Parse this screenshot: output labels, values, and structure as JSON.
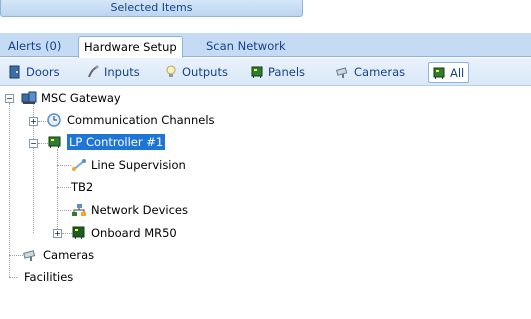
{
  "top": {
    "selected_items_label": "Selected Items"
  },
  "tabs": [
    {
      "label": "Alerts (0)",
      "active": false
    },
    {
      "label": "Hardware Setup",
      "active": true
    },
    {
      "label": "Scan Network",
      "active": false
    }
  ],
  "filters": [
    {
      "label": "Doors",
      "icon": "door-icon"
    },
    {
      "label": "Inputs",
      "icon": "input-icon"
    },
    {
      "label": "Outputs",
      "icon": "lightbulb-icon"
    },
    {
      "label": "Panels",
      "icon": "panel-board-icon"
    },
    {
      "label": "Cameras",
      "icon": "camera-icon"
    },
    {
      "label": "All",
      "icon": "all-icon",
      "active": true
    }
  ],
  "tree": {
    "gateway": "MSC Gateway",
    "comm_channels": "Communication Channels",
    "controller": "LP Controller #1",
    "line_supervision": "Line Supervision",
    "tb2": "TB2",
    "network_devices": "Network Devices",
    "onboard": "Onboard MR50",
    "cameras": "Cameras",
    "facilities": "Facilities"
  },
  "colors": {
    "selection": "#1e75d6",
    "tab_bar": "#c5dbf4",
    "accent_text": "#15428b"
  }
}
